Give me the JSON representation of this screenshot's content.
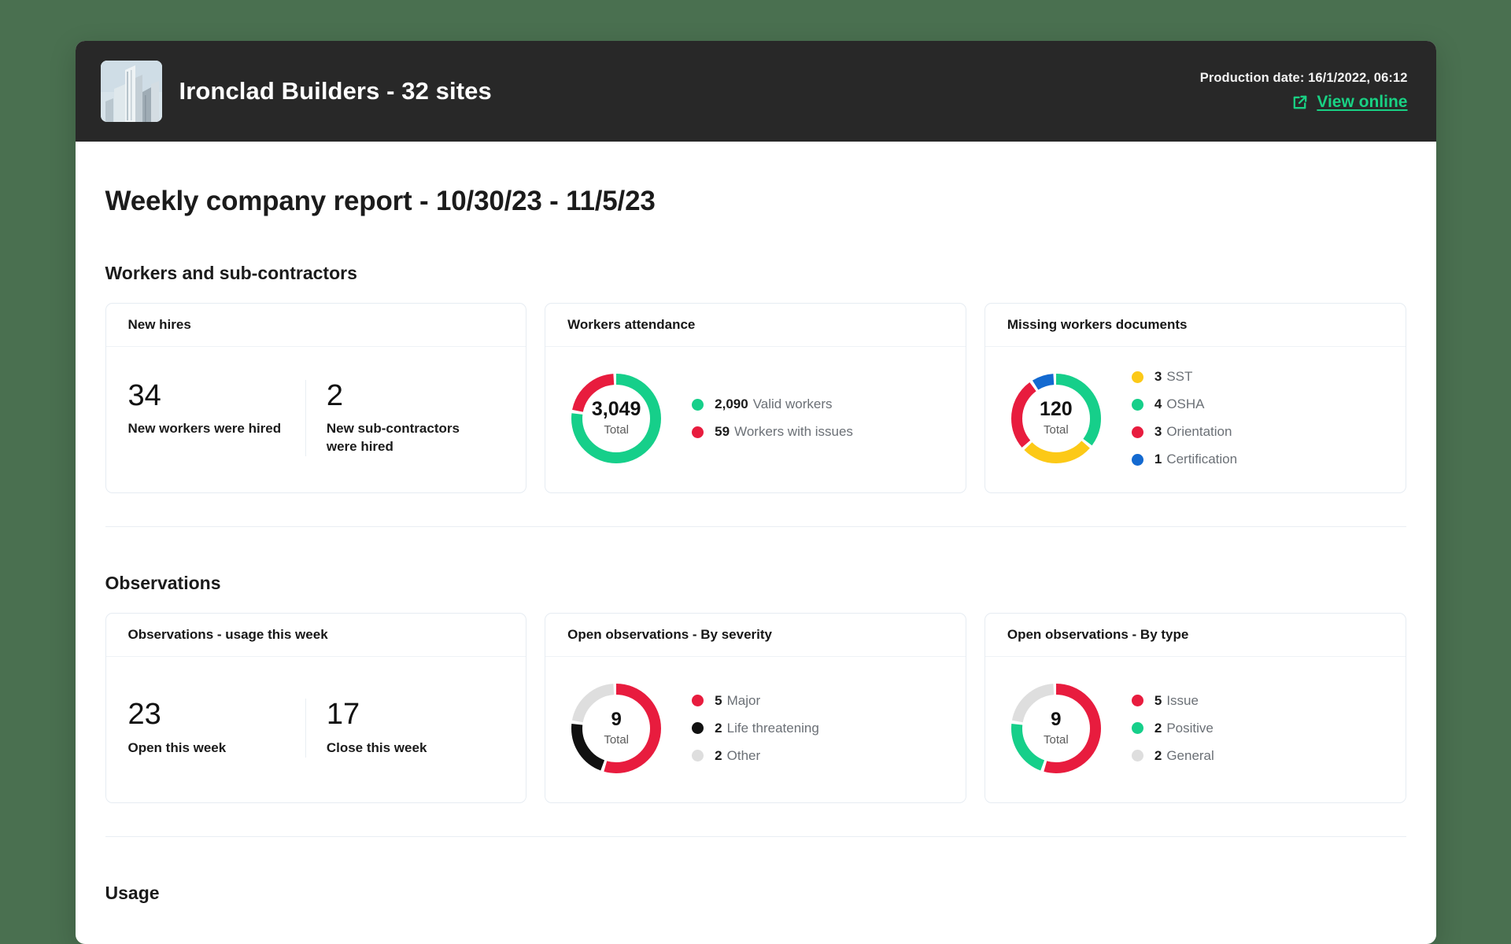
{
  "theme": {
    "page_background": "#4a7050",
    "header_background": "#282828",
    "accent_green": "#19d184",
    "donut_green": "#16cf8a",
    "donut_red": "#e81c3e",
    "donut_yellow": "#fcc917",
    "donut_blue": "#1369d0",
    "donut_black": "#111111",
    "donut_gray": "#dedede"
  },
  "header": {
    "logo_icon": "building-photo",
    "title": "Ironclad Builders - 32 sites",
    "production_date": "Production date: 16/1/2022, 06:12",
    "view_online_label": "View online",
    "view_online_icon": "external-link-icon"
  },
  "report": {
    "title": "Weekly company report - 10/30/23 - 11/5/23"
  },
  "sections": [
    {
      "id": "workers",
      "title": "Workers and sub-contractors"
    },
    {
      "id": "observations",
      "title": "Observations"
    },
    {
      "id": "usage",
      "title": "Usage"
    }
  ],
  "cards": {
    "new_hires": {
      "title": "New hires",
      "stats": [
        {
          "value": "34",
          "label": "New workers were hired"
        },
        {
          "value": "2",
          "label": "New sub-contractors were hired"
        }
      ]
    },
    "workers_attendance": {
      "title": "Workers attendance",
      "total": "3,049",
      "total_label": "Total",
      "legend": [
        {
          "color": "#16cf8a",
          "value": "2,090",
          "label": "Valid workers"
        },
        {
          "color": "#e81c3e",
          "value": "59",
          "label": "Workers with issues"
        }
      ]
    },
    "missing_documents": {
      "title": "Missing workers documents",
      "total": "120",
      "total_label": "Total",
      "legend": [
        {
          "color": "#fcc917",
          "value": "3",
          "label": "SST"
        },
        {
          "color": "#16cf8a",
          "value": "4",
          "label": "OSHA"
        },
        {
          "color": "#e81c3e",
          "value": "3",
          "label": "Orientation"
        },
        {
          "color": "#1369d0",
          "value": "1",
          "label": "Certification"
        }
      ]
    },
    "observations_usage": {
      "title": "Observations - usage this week",
      "stats": [
        {
          "value": "23",
          "label": "Open this week"
        },
        {
          "value": "17",
          "label": "Close this week"
        }
      ]
    },
    "open_by_severity": {
      "title": "Open observations - By severity",
      "total": "9",
      "total_label": "Total",
      "legend": [
        {
          "color": "#e81c3e",
          "value": "5",
          "label": "Major"
        },
        {
          "color": "#111111",
          "value": "2",
          "label": "Life threatening"
        },
        {
          "color": "#dedede",
          "value": "2",
          "label": "Other"
        }
      ]
    },
    "open_by_type": {
      "title": "Open observations - By type",
      "total": "9",
      "total_label": "Total",
      "legend": [
        {
          "color": "#e81c3e",
          "value": "5",
          "label": "Issue"
        },
        {
          "color": "#16cf8a",
          "value": "2",
          "label": "Positive"
        },
        {
          "color": "#dedede",
          "value": "2",
          "label": "General"
        }
      ]
    }
  },
  "chart_data": [
    {
      "id": "workers_attendance",
      "type": "pie",
      "title": "Workers attendance",
      "center_value": "3,049",
      "center_label": "Total",
      "labels": [
        "Valid workers",
        "Workers with issues"
      ],
      "values": [
        2090,
        59
      ],
      "render_fractions": [
        0.78,
        0.22
      ],
      "colors": [
        "#16cf8a",
        "#e81c3e"
      ],
      "legend_position": "right",
      "direction": "green clockwise from top, red counter-clockwise from top"
    },
    {
      "id": "missing_documents",
      "type": "pie",
      "title": "Missing workers documents",
      "center_value": "120",
      "center_label": "Total",
      "labels": [
        "OSHA",
        "SST",
        "Orientation",
        "Certification"
      ],
      "values": [
        4,
        3,
        3,
        1
      ],
      "render_fractions": [
        0.364,
        0.273,
        0.273,
        0.09
      ],
      "colors": [
        "#16cf8a",
        "#fcc917",
        "#e81c3e",
        "#1369d0"
      ],
      "legend_position": "right",
      "legend_order": [
        "SST",
        "OSHA",
        "Orientation",
        "Certification"
      ]
    },
    {
      "id": "open_by_severity",
      "type": "pie",
      "title": "Open observations - By severity",
      "center_value": "9",
      "center_label": "Total",
      "labels": [
        "Major",
        "Life threatening",
        "Other"
      ],
      "values": [
        5,
        2,
        2
      ],
      "render_fractions": [
        0.5556,
        0.2222,
        0.2222
      ],
      "colors": [
        "#e81c3e",
        "#111111",
        "#dedede"
      ],
      "legend_position": "right"
    },
    {
      "id": "open_by_type",
      "type": "pie",
      "title": "Open observations - By type",
      "center_value": "9",
      "center_label": "Total",
      "labels": [
        "Issue",
        "Positive",
        "General"
      ],
      "values": [
        5,
        2,
        2
      ],
      "render_fractions": [
        0.5556,
        0.2222,
        0.2222
      ],
      "colors": [
        "#e81c3e",
        "#16cf8a",
        "#dedede"
      ],
      "legend_position": "right"
    }
  ]
}
